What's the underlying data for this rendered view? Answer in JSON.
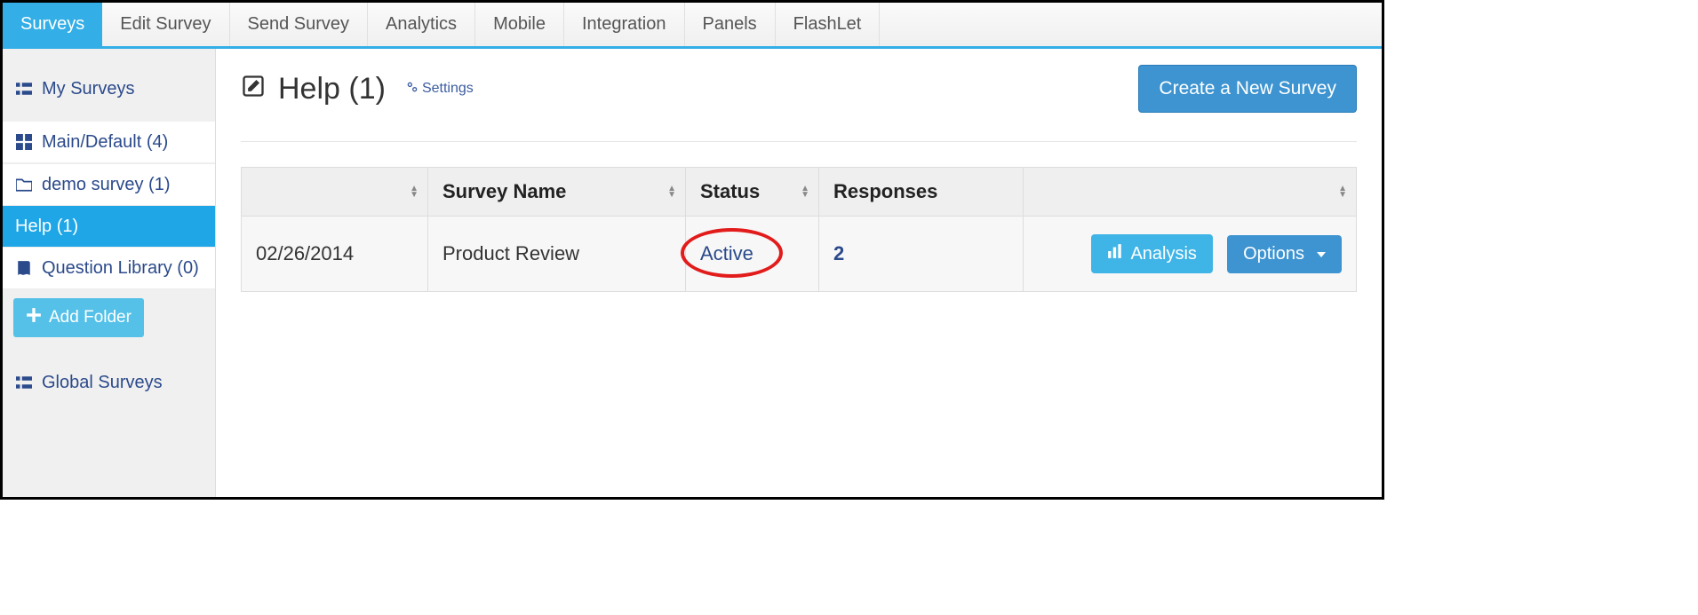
{
  "topnav": {
    "items": [
      {
        "label": "Surveys",
        "active": true
      },
      {
        "label": "Edit Survey"
      },
      {
        "label": "Send Survey"
      },
      {
        "label": "Analytics"
      },
      {
        "label": "Mobile"
      },
      {
        "label": "Integration"
      },
      {
        "label": "Panels"
      },
      {
        "label": "FlashLet"
      }
    ]
  },
  "sidebar": {
    "my_surveys": "My Surveys",
    "main_default": "Main/Default (4)",
    "demo_survey": "demo survey (1)",
    "help": "Help  (1)",
    "question_library": "Question Library (0)",
    "add_folder": "Add Folder",
    "global_surveys": "Global Surveys"
  },
  "header": {
    "title": "Help  (1)",
    "settings": "Settings",
    "create_button": "Create a New Survey"
  },
  "table": {
    "columns": {
      "date": "",
      "name": "Survey Name",
      "status": "Status",
      "responses": "Responses",
      "actions": ""
    },
    "rows": [
      {
        "date": "02/26/2014",
        "name": "Product Review",
        "status": "Active",
        "responses": "2",
        "analysis_label": "Analysis",
        "options_label": "Options"
      }
    ]
  }
}
